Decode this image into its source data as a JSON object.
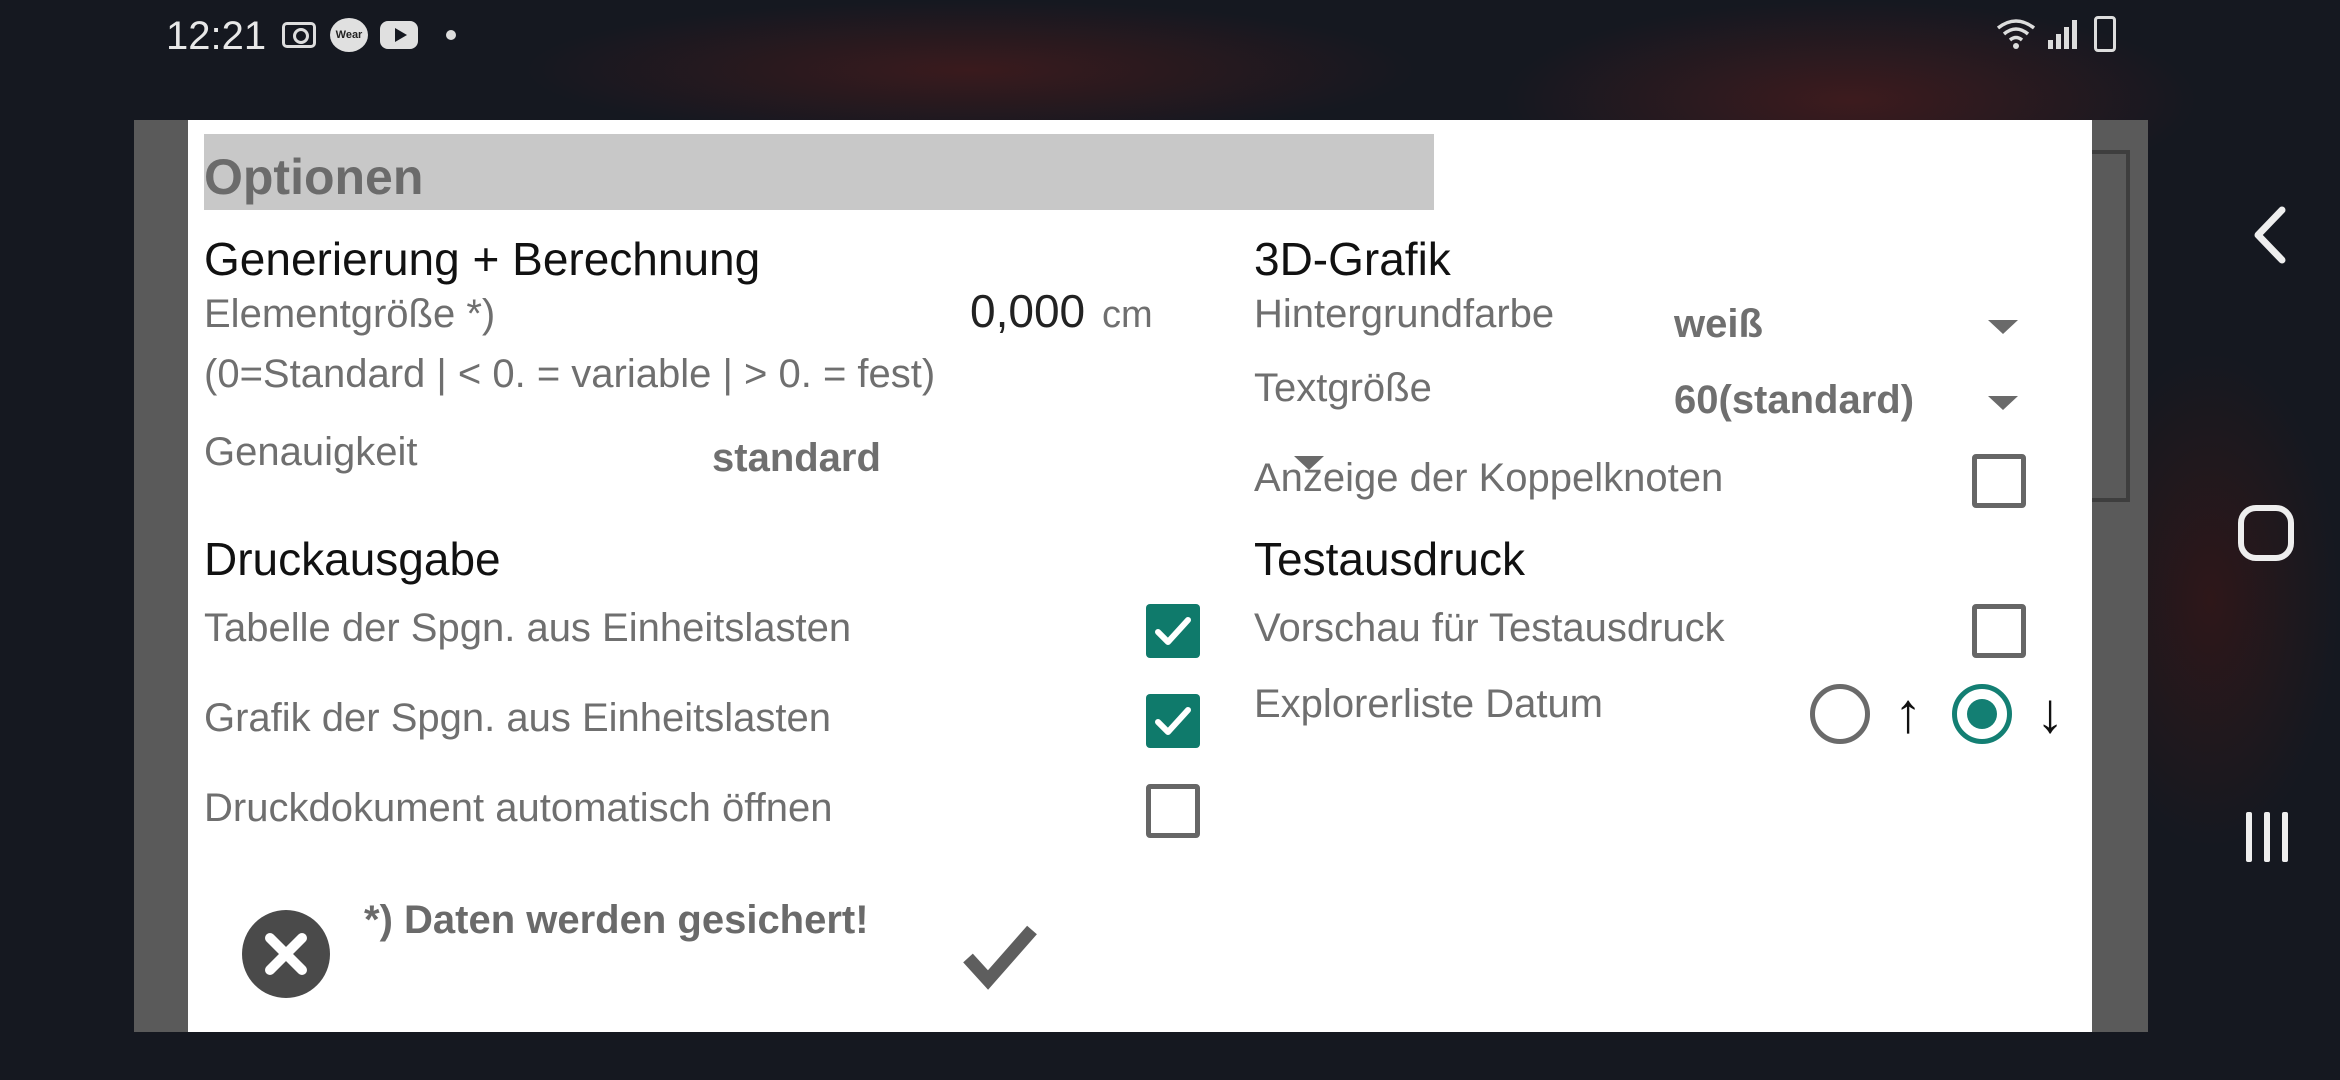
{
  "status_bar": {
    "time": "12:21",
    "icons": [
      "camera-icon",
      "wear-icon",
      "youtube-icon",
      "dot-icon",
      "wifi-icon",
      "signal-icon",
      "battery-icon"
    ],
    "wear_text": "Wear"
  },
  "dialog": {
    "title": "Optionen",
    "left": {
      "generation": {
        "heading": "Generierung + Berechnung",
        "element_size_label": "Elementgröße *)",
        "element_size_value": "0,000",
        "element_size_unit": "cm",
        "element_size_hint": "(0=Standard | < 0. = variable | > 0. = fest)",
        "accuracy_label": "Genauigkeit",
        "accuracy_value": "standard"
      },
      "print": {
        "heading": "Druckausgabe",
        "items": [
          {
            "label": "Tabelle der Spgn. aus Einheitslasten",
            "checked": true
          },
          {
            "label": "Grafik der Spgn. aus Einheitslasten",
            "checked": true
          },
          {
            "label": "Druckdokument automatisch öffnen",
            "checked": false
          }
        ]
      }
    },
    "right": {
      "graphics": {
        "heading": "3D-Grafik",
        "background_label": "Hintergrundfarbe",
        "background_value": "weiß",
        "text_size_label": "Textgröße",
        "text_size_value": "60(standard)",
        "coupling_nodes_label": "Anzeige der Koppelknoten",
        "coupling_nodes_checked": false
      },
      "test_print": {
        "heading": "Testausdruck",
        "preview_label": "Vorschau für Testausdruck",
        "preview_checked": false,
        "explorer_label": "Explorerliste Datum",
        "sort_up_glyph": "↑",
        "sort_down_glyph": "↓",
        "selected_sort": "down"
      }
    },
    "footnote": "*) Daten werden gesichert!"
  },
  "colors": {
    "accent": "#0f7a6b",
    "title_bar": "#c8c8c8",
    "label_text": "#6f6f6f"
  }
}
